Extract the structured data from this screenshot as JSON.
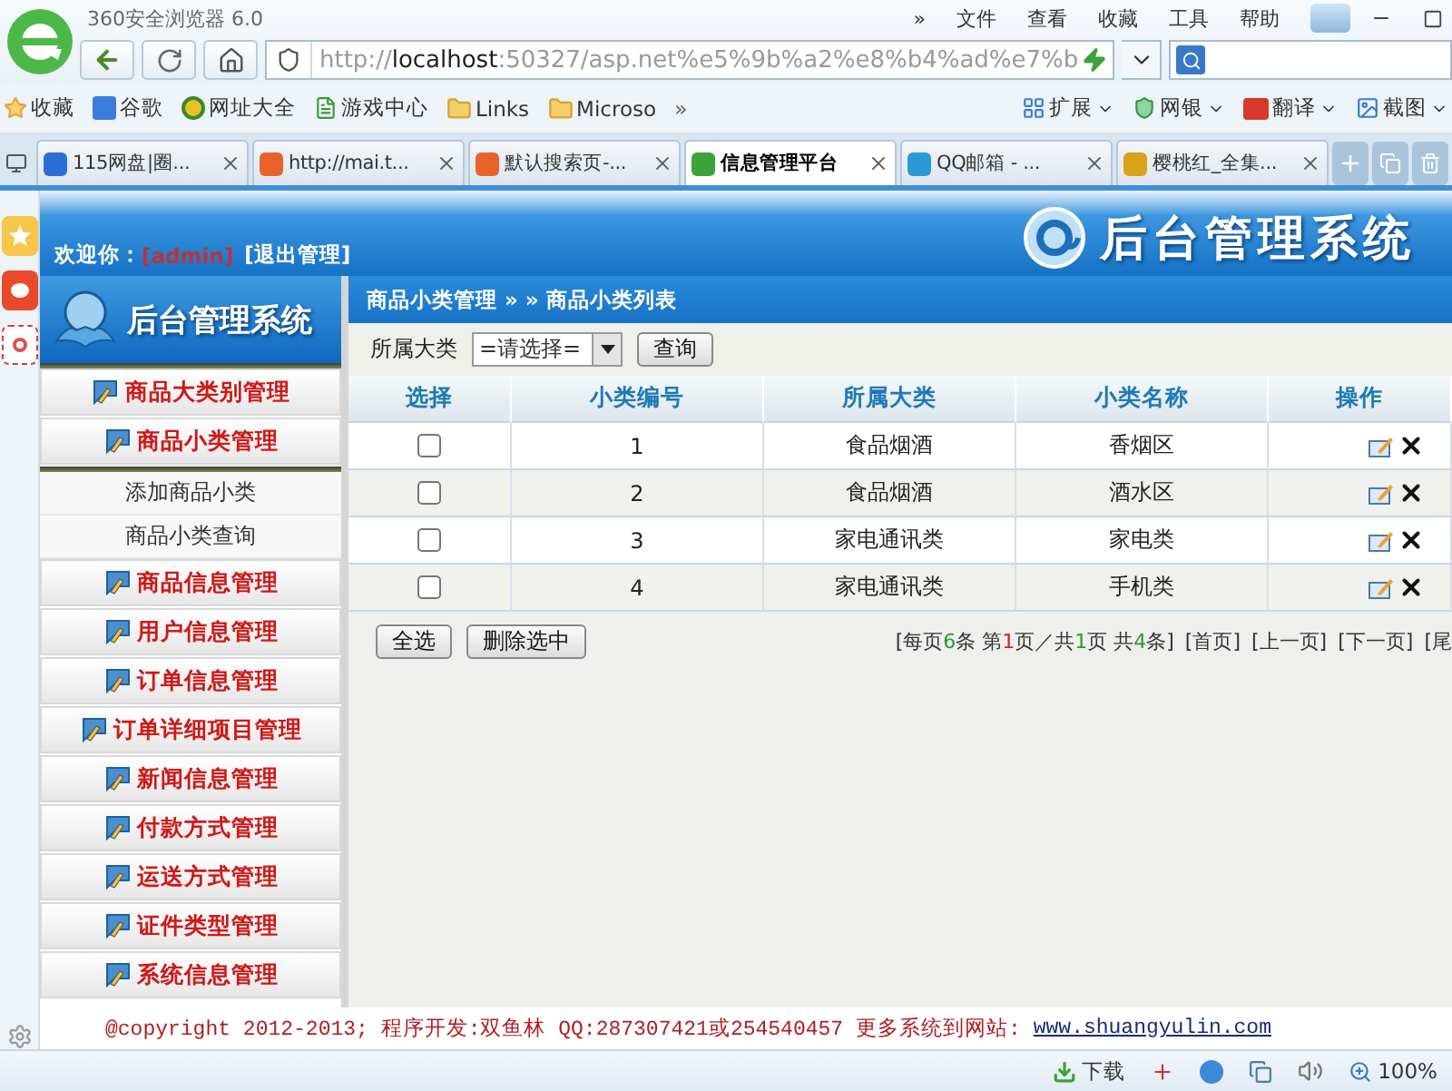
{
  "browser": {
    "title": "360安全浏览器 6.0",
    "menu": [
      "»",
      "文件",
      "查看",
      "收藏",
      "工具",
      "帮助"
    ],
    "address": {
      "scheme": "http://",
      "host": "localhost",
      "rest": ":50327/asp.net%e5%9b%a2%e8%b4%ad%e7%b"
    },
    "bookmarks": [
      {
        "label": "收藏",
        "kind": "star"
      },
      {
        "label": "谷歌",
        "kind": "square"
      },
      {
        "label": "网址大全",
        "kind": "circle"
      },
      {
        "label": "游戏中心",
        "kind": "page"
      },
      {
        "label": "Links",
        "kind": "folder"
      },
      {
        "label": "Microso",
        "kind": "folder"
      }
    ],
    "bookmarks_more": "»",
    "tools": [
      {
        "label": "扩展",
        "kind": "grid"
      },
      {
        "label": "网银",
        "kind": "shield"
      },
      {
        "label": "翻译",
        "kind": "badge"
      },
      {
        "label": "截图",
        "kind": "image"
      }
    ],
    "tabs": [
      {
        "label": "115网盘|圈...",
        "selected": false,
        "color": "#2a6fd6"
      },
      {
        "label": "http://mai.t...",
        "selected": false,
        "color": "#e8622a"
      },
      {
        "label": "默认搜索页-...",
        "selected": false,
        "color": "#e8622a"
      },
      {
        "label": "信息管理平台",
        "selected": true,
        "color": "#3aa33a"
      },
      {
        "label": "QQ邮箱 - ...",
        "selected": false,
        "color": "#2a9ad6"
      },
      {
        "label": "樱桃红_全集...",
        "selected": false,
        "color": "#d9a21b"
      }
    ],
    "status_bar": {
      "download": "下载",
      "zoom": "100%"
    }
  },
  "page": {
    "welcome": {
      "label": "欢迎你：",
      "user": "[admin]",
      "logout": "[退出管理]"
    },
    "header_title": "后台管理系统",
    "sidebar": {
      "title": "后台管理系统",
      "sections": [
        {
          "label": "商品大类别管理"
        },
        {
          "label": "商品小类管理",
          "children": [
            {
              "label": "添加商品小类"
            },
            {
              "label": "商品小类查询"
            }
          ]
        },
        {
          "label": "商品信息管理"
        },
        {
          "label": "用户信息管理"
        },
        {
          "label": "订单信息管理"
        },
        {
          "label": "订单详细项目管理"
        },
        {
          "label": "新闻信息管理"
        },
        {
          "label": "付款方式管理"
        },
        {
          "label": "运送方式管理"
        },
        {
          "label": "证件类型管理"
        },
        {
          "label": "系统信息管理"
        }
      ]
    },
    "breadcrumb": "商品小类管理 » » 商品小类列表",
    "filter": {
      "label": "所属大类",
      "select": "=请选择=",
      "button": "查询"
    },
    "table": {
      "columns": [
        "选择",
        "小类编号",
        "所属大类",
        "小类名称",
        "操作"
      ],
      "rows": [
        {
          "checked": false,
          "cells": [
            "",
            "1",
            "食品烟酒",
            "香烟区"
          ]
        },
        {
          "checked": false,
          "cells": [
            "",
            "2",
            "食品烟酒",
            "酒水区"
          ]
        },
        {
          "checked": false,
          "cells": [
            "",
            "3",
            "家电通讯类",
            "家电类"
          ]
        },
        {
          "checked": false,
          "cells": [
            "",
            "4",
            "家电通讯类",
            "手机类"
          ]
        }
      ]
    },
    "buttons": [
      "全选",
      "删除选中"
    ],
    "pager": {
      "parts": [
        {
          "text": "[每页",
          "color": "#333333"
        },
        {
          "text": "6",
          "color": "#2a9a2a"
        },
        {
          "text": "条 第",
          "color": "#333333"
        },
        {
          "text": "1",
          "color": "#d42020"
        },
        {
          "text": "页／共",
          "color": "#333333"
        },
        {
          "text": "1",
          "color": "#2a9a2a"
        },
        {
          "text": "页 共",
          "color": "#333333"
        },
        {
          "text": "4",
          "color": "#2a9a2a"
        },
        {
          "text": "条]",
          "color": "#333333"
        }
      ],
      "links": [
        "[首页]",
        "[上一页]",
        "[下一页]",
        "[尾"
      ]
    },
    "footer": {
      "text": "@copyright 2012-2013; 程序开发:双鱼林  QQ:287307421或254540457  更多系统到网站:",
      "link": "www.shuangyulin.com"
    }
  }
}
